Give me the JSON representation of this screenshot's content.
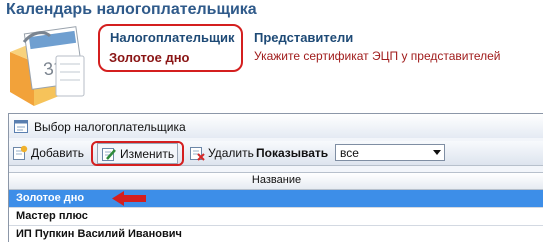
{
  "page": {
    "title": "Календарь налогоплательщика"
  },
  "header": {
    "taxpayer_label": "Налогоплательщик",
    "taxpayer_value": "Золотое дно",
    "representatives_label": "Представители",
    "representatives_hint": "Укажите сертификат ЭЦП у представителей"
  },
  "dialog": {
    "title": "Выбор налогоплательщика",
    "toolbar": {
      "add_label": "Добавить",
      "edit_label": "Изменить",
      "delete_label": "Удалить",
      "show_label": "Показывать",
      "show_value": "все"
    },
    "grid": {
      "column_name": "Название",
      "rows": [
        {
          "name": "Золотое дно",
          "selected": true
        },
        {
          "name": "Мастер плюс",
          "selected": false
        },
        {
          "name": "ИП Пупкин Василий Иванович",
          "selected": false
        }
      ]
    }
  },
  "icons": [
    "calendar-icon",
    "dialog-window-icon",
    "add-icon",
    "edit-icon",
    "delete-icon",
    "dropdown-arrow-icon",
    "pointer-arrow-icon"
  ],
  "colors": {
    "highlight": "#d41f1f",
    "selection": "#3d8ee8",
    "title": "#2f5a8a",
    "taxpayer_value": "#8a1515"
  }
}
